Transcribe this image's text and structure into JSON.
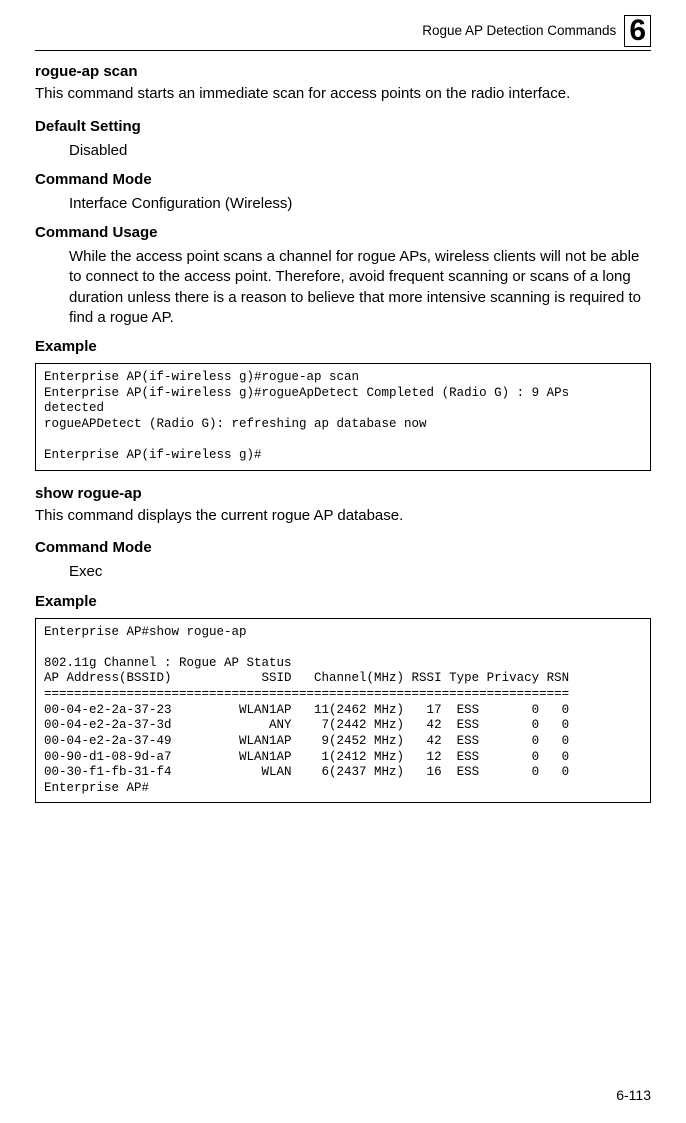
{
  "header": {
    "title": "Rogue AP Detection Commands",
    "chapter": "6"
  },
  "cmd1": {
    "name": "rogue-ap scan",
    "desc": "This command starts an immediate scan for access points on the radio interface.",
    "default_label": "Default Setting",
    "default_value": "Disabled",
    "mode_label": "Command Mode",
    "mode_value": "Interface Configuration (Wireless)",
    "usage_label": "Command Usage",
    "usage_value": "While the access point scans a channel for rogue APs, wireless clients will not be able to connect to the access point. Therefore, avoid frequent scanning or scans of a long duration unless there is a reason to believe that more intensive scanning is required to find a rogue AP.",
    "example_label": "Example",
    "example_code": "Enterprise AP(if-wireless g)#rogue-ap scan\nEnterprise AP(if-wireless g)#rogueApDetect Completed (Radio G) : 9 APs \ndetected\nrogueAPDetect (Radio G): refreshing ap database now\n\nEnterprise AP(if-wireless g)#"
  },
  "cmd2": {
    "name": "show rogue-ap",
    "desc": "This command displays the current rogue AP database.",
    "mode_label": "Command Mode",
    "mode_value": "Exec",
    "example_label": "Example",
    "example_code": "Enterprise AP#show rogue-ap\n\n802.11g Channel : Rogue AP Status\nAP Address(BSSID)            SSID   Channel(MHz) RSSI Type Privacy RSN\n======================================================================\n00-04-e2-2a-37-23         WLAN1AP   11(2462 MHz)   17  ESS       0   0\n00-04-e2-2a-37-3d             ANY    7(2442 MHz)   42  ESS       0   0\n00-04-e2-2a-37-49         WLAN1AP    9(2452 MHz)   42  ESS       0   0\n00-90-d1-08-9d-a7         WLAN1AP    1(2412 MHz)   12  ESS       0   0\n00-30-f1-fb-31-f4            WLAN    6(2437 MHz)   16  ESS       0   0\nEnterprise AP#"
  },
  "footer": {
    "page": "6-113"
  }
}
